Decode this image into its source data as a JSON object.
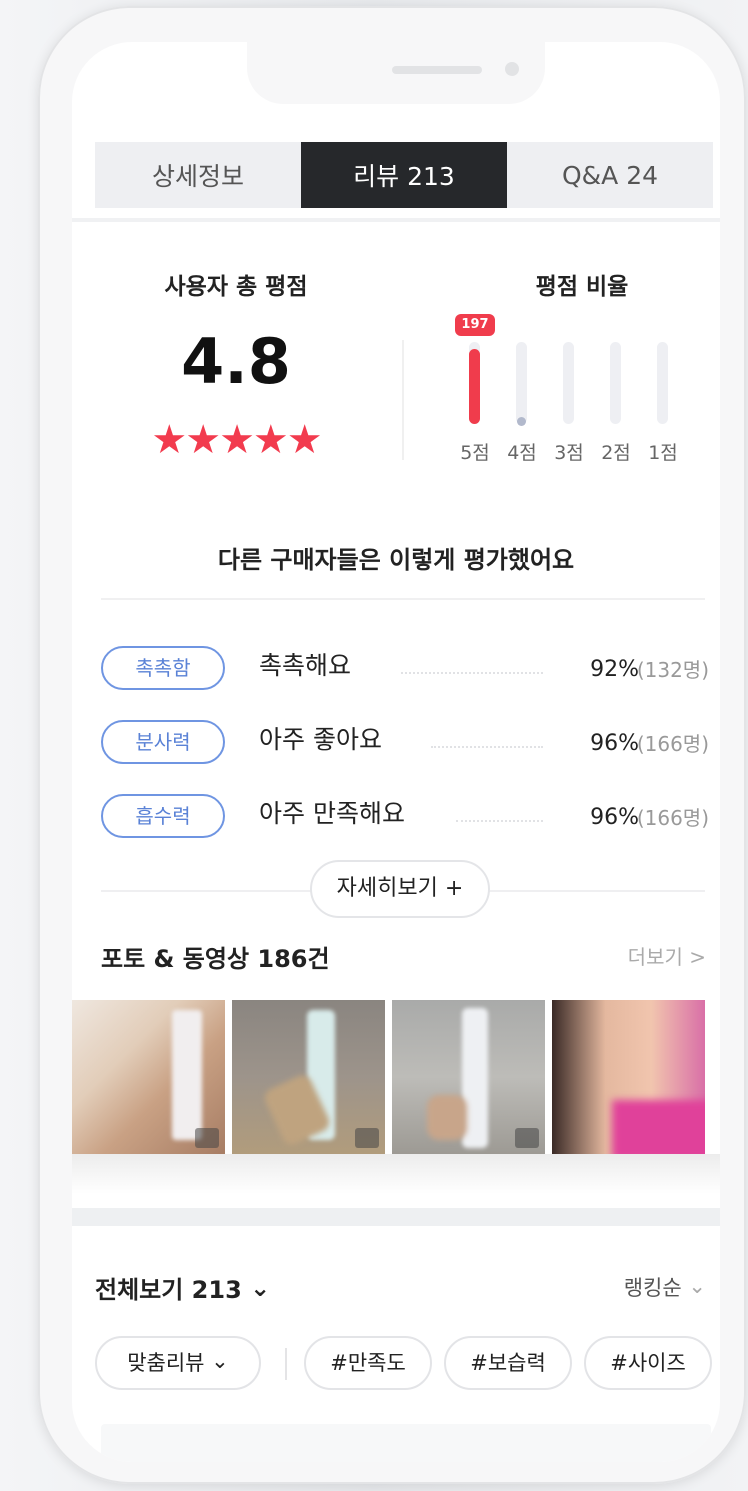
{
  "tabs": [
    {
      "label": "상세정보",
      "active": false
    },
    {
      "label": "리뷰 213",
      "active": true
    },
    {
      "label": "Q&A 24",
      "active": false
    }
  ],
  "rating": {
    "title": "사용자 총 평점",
    "score": "4.8",
    "stars": "★★★★★",
    "star_color": "#f23b4e"
  },
  "ratio": {
    "title": "평점 비율",
    "top_count": "197",
    "bars": [
      {
        "label": "5점",
        "fraction": 0.92
      },
      {
        "label": "4점",
        "fraction": 0.05
      },
      {
        "label": "3점",
        "fraction": 0
      },
      {
        "label": "2점",
        "fraction": 0
      },
      {
        "label": "1점",
        "fraction": 0
      }
    ]
  },
  "evaluation": {
    "title": "다른 구매자들은 이렇게 평가했어요",
    "rows": [
      {
        "tag": "촉촉함",
        "text": "촉촉해요",
        "pct": "92%",
        "count": "(132명)"
      },
      {
        "tag": "분사력",
        "text": "아주 좋아요",
        "pct": "96%",
        "count": "(166명)"
      },
      {
        "tag": "흡수력",
        "text": "아주 만족해요",
        "pct": "96%",
        "count": "(166명)"
      }
    ],
    "more_label": "자세히보기 +"
  },
  "photos": {
    "title": "포토 & 동영상 186건",
    "more_label": "더보기 >"
  },
  "list": {
    "all_label": "전체보기 213",
    "sort_label": "랭킹순",
    "filter_main": "맞춤리뷰",
    "chips": [
      "#만족도",
      "#보습력",
      "#사이즈"
    ]
  },
  "colors": {
    "accent": "#f03c4c",
    "tag_blue": "#5a82d6",
    "tab_active_bg": "#26282b"
  }
}
